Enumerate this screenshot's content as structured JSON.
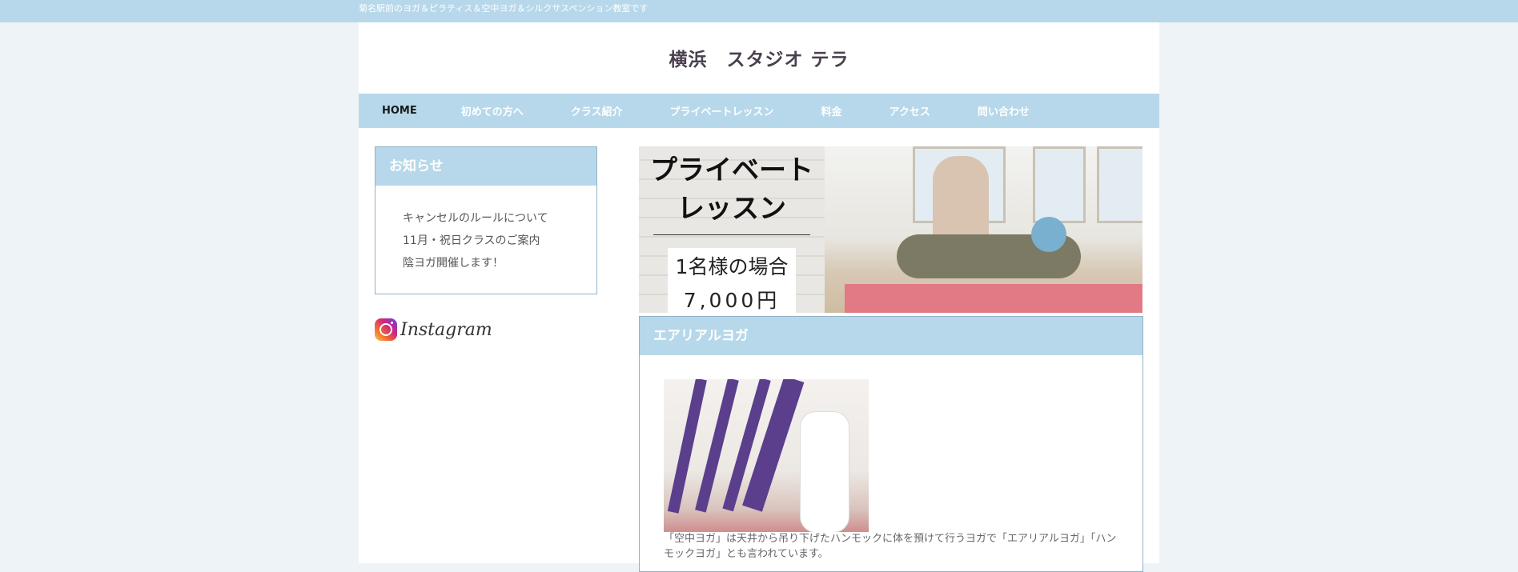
{
  "topbar": {
    "tagline": "菊名駅前のヨガ＆ピラティス＆空中ヨガ＆シルクサスペンション教室です"
  },
  "header": {
    "title": "横浜　スタジオ テラ"
  },
  "nav": {
    "items": [
      {
        "label": "HOME",
        "active": true
      },
      {
        "label": "初めての方へ"
      },
      {
        "label": "クラス紹介"
      },
      {
        "label": "プライベートレッスン"
      },
      {
        "label": "料金"
      },
      {
        "label": "アクセス"
      },
      {
        "label": "問い合わせ"
      }
    ]
  },
  "sidebar": {
    "notice_title": "お知らせ",
    "notices": [
      "キャンセルのルールについて",
      "11月・祝日クラスのご案内",
      "陰ヨガ開催します！"
    ],
    "instagram_label": "Instagram"
  },
  "banner": {
    "title_line1": "プライベート",
    "title_line2": "レッスン",
    "price_line1": "1名様の場合",
    "price_line2": "7,000円"
  },
  "aerial": {
    "title": "エアリアルヨガ",
    "description": "「空中ヨガ」は天井から吊り下げたハンモックに体を預けて行うヨガで「エアリアルヨガ」「ハンモックヨガ」とも言われています。"
  },
  "colors": {
    "accent": "#b7d8ea",
    "border": "#8fb3c9",
    "background": "#eef3f8"
  }
}
